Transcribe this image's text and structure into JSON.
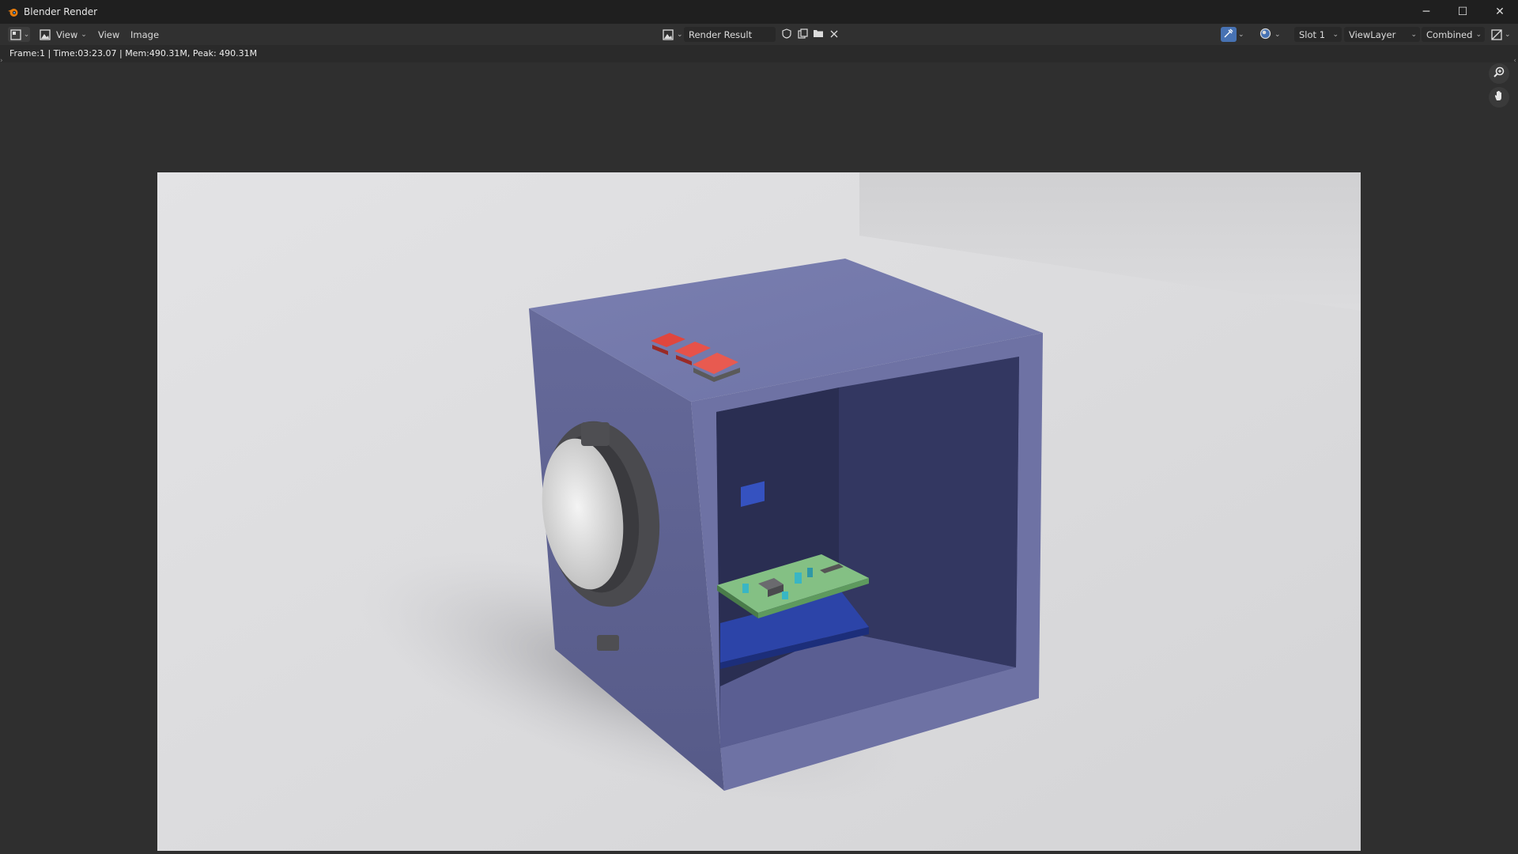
{
  "window": {
    "title": "Blender Render",
    "controls": {
      "minimize": "─",
      "maximize": "☐",
      "close": "✕"
    }
  },
  "header": {
    "editor_type_icon": "image-editor-icon",
    "mode_icon": "view-mode-icon",
    "view_dropdown_label": "View",
    "menus": [
      "View",
      "Image"
    ],
    "image_browse_icon": "image-browse-icon",
    "image_name": "Render Result",
    "image_actions": [
      "fake-user-shield-icon",
      "new-image-icon",
      "open-folder-icon",
      "unlink-x-icon"
    ],
    "slot": "Slot 1",
    "view_layer": "ViewLayer",
    "render_pass": "Combined",
    "right_icons": [
      "sample-tool-icon",
      "display-channels-icon",
      "display-view-icon"
    ]
  },
  "status": {
    "text": "Frame:1 | Time:03:23.07 | Mem:490.31M, Peak: 490.31M"
  },
  "viewport": {
    "tools": [
      "zoom-icon",
      "pan-hand-icon"
    ],
    "render_alt": ""
  },
  "colors": {
    "title_bar": "#1f1f1f",
    "header": "#303030",
    "viewport": "#2f2f2f",
    "active_icon": "#4772b3",
    "box": "#6b6f9e",
    "buttons": "#e0463e",
    "pcb": "#7ab87a",
    "arduino_board": "#2c44a8"
  }
}
